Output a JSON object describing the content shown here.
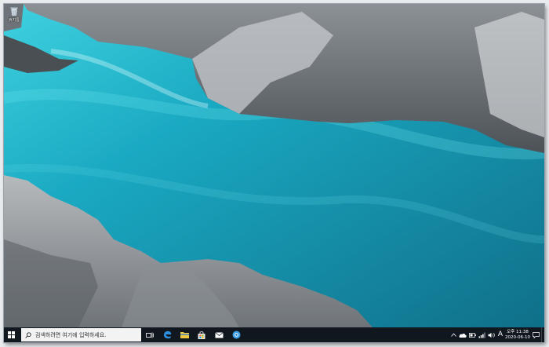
{
  "desktop": {
    "icons": [
      {
        "label": "휴지통",
        "icon": "recycle-bin-icon"
      }
    ]
  },
  "taskbar": {
    "search": {
      "placeholder": "검색하려면 여기에 입력하세요."
    },
    "pinned_apps": [
      "task-view-icon",
      "edge-icon",
      "file-explorer-icon",
      "store-icon",
      "mail-icon",
      "browser-icon"
    ],
    "tray": {
      "ime_indicator": "A",
      "time": "오후 11:38",
      "date": "2020-06-10"
    }
  },
  "colors": {
    "taskbar_bg": "#10171e",
    "water": "#1b8fa7",
    "accent": "#0078d7"
  }
}
